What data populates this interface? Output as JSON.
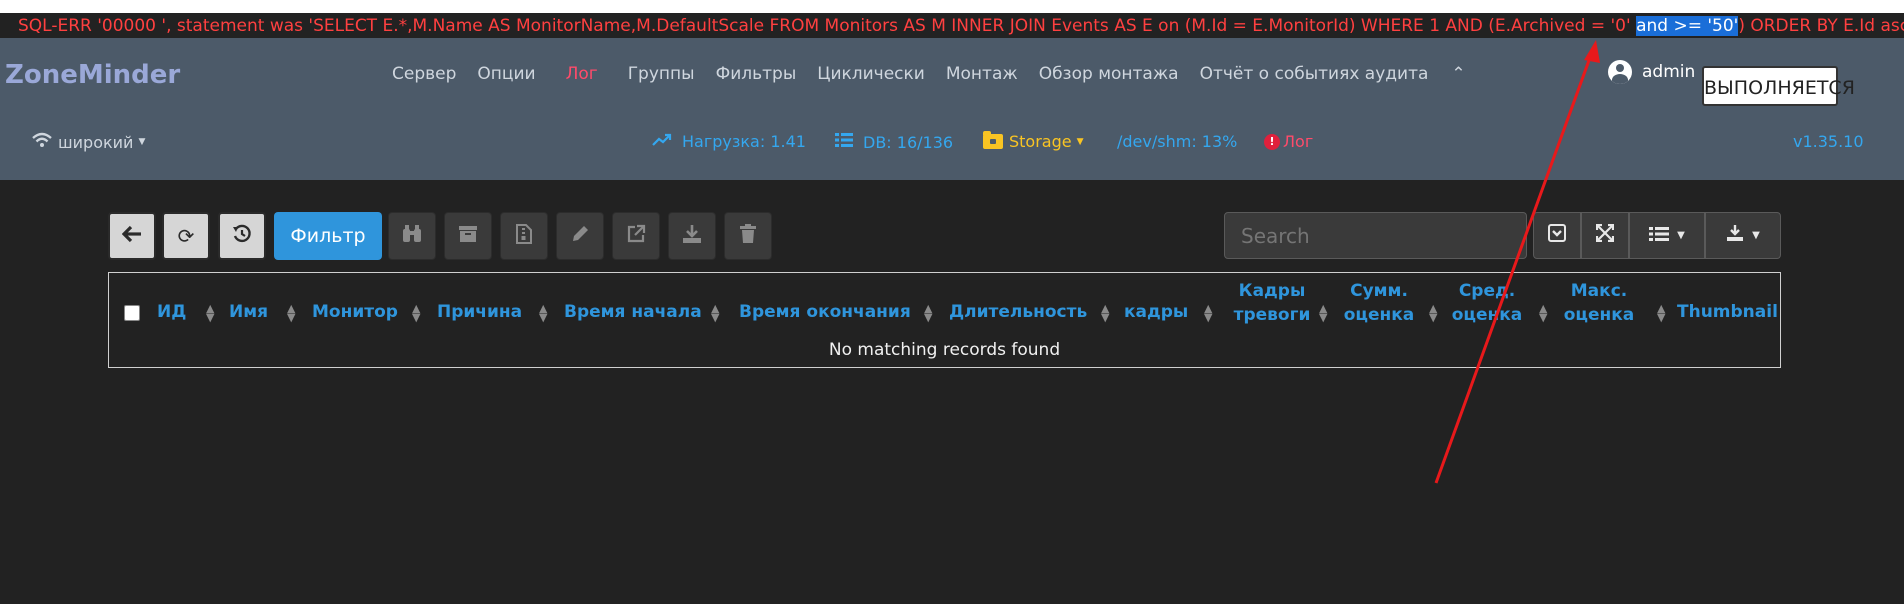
{
  "sql_error": {
    "before": "SQL-ERR '00000 ', statement was 'SELECT E.*,M.Name AS MonitorName,M.DefaultScale FROM Monitors AS M INNER JOIN Events AS E on (M.Id = E.MonitorId) WHERE 1 AND (E.Archived = '0' ",
    "selected": "and >= '50'",
    "after": ") ORDER BY E.Id asc'"
  },
  "brand": "ZoneMinder",
  "menu": [
    "Сервер",
    "Опции",
    "Лог",
    "Группы",
    "Фильтры",
    "Циклически",
    "Монтаж",
    "Обзор монтажа",
    "Отчёт о событиях аудита"
  ],
  "user": "admin",
  "running_button": "ВЫПОЛНЯЕТСЯ",
  "status": {
    "bandwidth": "широкий",
    "load": "Нагрузка: 1.41",
    "db": "DB: 16/136",
    "storage": "Storage",
    "shm": "/dev/shm: 13%",
    "log": "Лог",
    "version": "v1.35.10"
  },
  "toolbar": {
    "filter_label": "Фильтр"
  },
  "search": {
    "placeholder": "Search"
  },
  "table": {
    "columns": [
      "ИД",
      "Имя",
      "Монитор",
      "Причина",
      "Время начала",
      "Время окончания",
      "Длительность",
      "кадры",
      "Кадры тревоги",
      "Сумм. оценка",
      "Сред. оценка",
      "Макс. оценка",
      "Thumbnail"
    ],
    "empty_message": "No matching records found"
  },
  "colors": {
    "accent": "#2f95dc",
    "error": "#ff4040",
    "navbar": "#4c5a69",
    "annotation_arrow": "#e8191b"
  }
}
